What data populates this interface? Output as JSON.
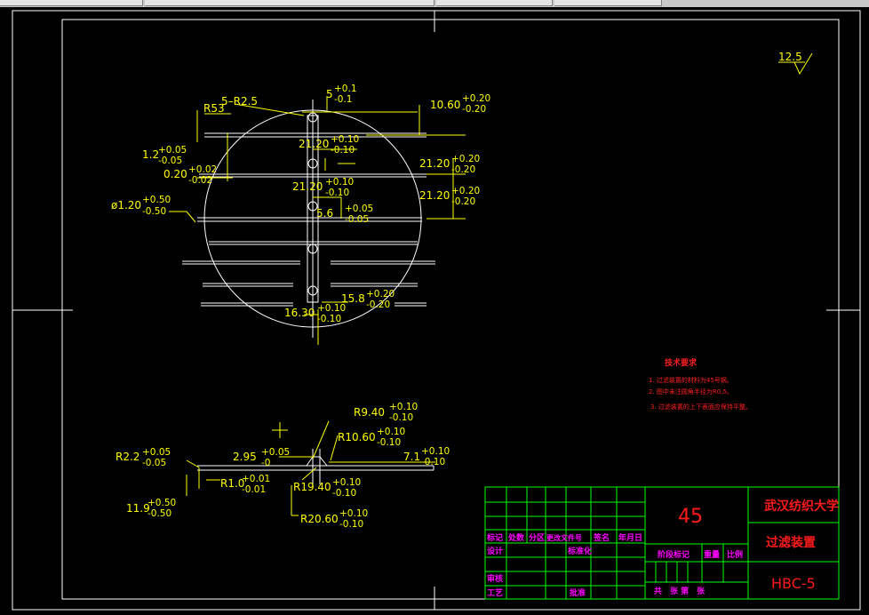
{
  "roughness": "12.5",
  "top_dims": {
    "r53": "R53",
    "r25": "5–R2.5",
    "d5": "5",
    "d5_up": "+0.1",
    "d5_lo": "-0.1",
    "d1060": "10.60",
    "d1060_up": "+0.20",
    "d1060_lo": "-0.20",
    "d12": "1.2",
    "d12_up": "+0.05",
    "d12_lo": "-0.05",
    "d2120a": "21.20",
    "d2120a_up": "+0.10",
    "d2120a_lo": "-0.10",
    "d020": "0.20",
    "d020_up": "+0.02",
    "d020_lo": "-0.02",
    "d2120b": "21.20",
    "d2120b_up": "+0.10",
    "d2120b_lo": "-0.10",
    "d2120c": "21.20",
    "d2120c_up": "+0.20",
    "d2120c_lo": "-0.20",
    "d2120d": "21.20",
    "d2120d_up": "+0.20",
    "d2120d_lo": "-0.20",
    "d120": "ø1.20",
    "d120_up": "+0.50",
    "d120_lo": "-0.50",
    "d56": "5.6",
    "d56_up": "+0.05",
    "d56_lo": "-0.05",
    "d158": "15.8",
    "d158_up": "+0.20",
    "d158_lo": "-0.20",
    "d1630": "16.30",
    "d1630_up": "+0.10",
    "d1630_lo": "-0.10"
  },
  "bottom_dims": {
    "r940": "R9.40",
    "r940_up": "+0.10",
    "r940_lo": "-0.10",
    "r1060": "R10.60",
    "r1060_up": "+0.10",
    "r1060_lo": "-0.10",
    "d295": "2.95",
    "d295_up": "+0.05",
    "d295_lo": "-0",
    "d71": "7.1",
    "d71_up": "+0.10",
    "d71_lo": "-0.10",
    "r22": "R2.2",
    "r22_up": "+0.05",
    "r22_lo": "-0.05",
    "r10": "R1.0",
    "r10_up": "+0.01",
    "r10_lo": "-0.01",
    "r1940": "R19.40",
    "r1940_up": "+0.10",
    "r1940_lo": "-0.10",
    "d119": "11.9",
    "d119_up": "+0.50",
    "d119_lo": "-0.50",
    "r2060": "R20.60",
    "r2060_up": "+0.10",
    "r2060_lo": "-0.10"
  },
  "tech": {
    "title": "技术要求",
    "items": [
      "1. 过滤装置的材料为45号钢。",
      "2. 图中未注圆角半径为R0.5。",
      "3. 过滤装置的上下表面应保持平整。"
    ]
  },
  "titleblock": {
    "material": "45",
    "school": "武汉纺织大学",
    "part_name": "过滤装置",
    "drawing_no": "HBC-5",
    "row_labels": [
      "标记",
      "处数",
      "分区",
      "更改文件号",
      "签名",
      "年月日"
    ],
    "design": "设计",
    "standard": "标准化",
    "stage": "阶段标记",
    "weight": "重量",
    "scale": "比例",
    "check": "审核",
    "process": "工艺",
    "approve": "批准",
    "sheets": "共　张 第　张"
  },
  "colors": {
    "frame": "#ffffff",
    "dim": "#ffff00",
    "titleblock": "#00ff00",
    "red": "#ff2020",
    "magenta": "#ff00ff"
  }
}
